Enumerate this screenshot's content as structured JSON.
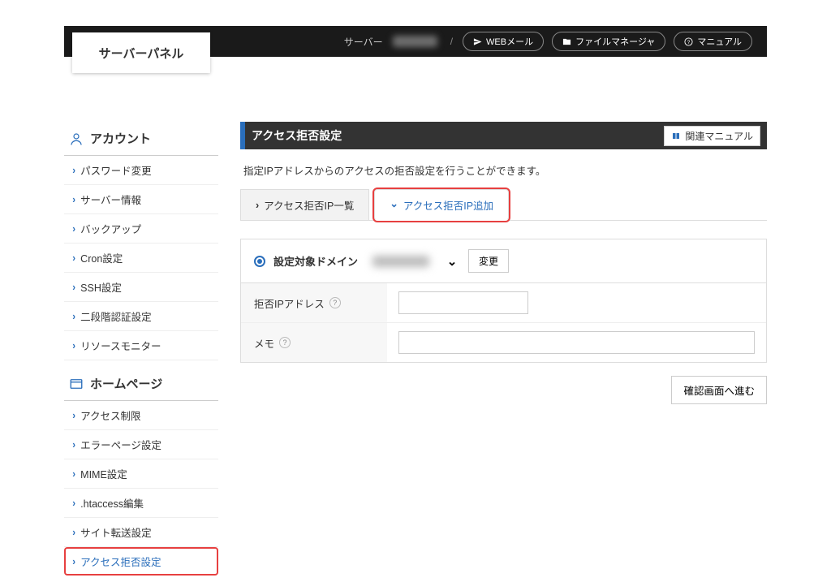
{
  "header": {
    "logo": "サーバーパネル",
    "server_label": "サーバー",
    "webmail": "WEBメール",
    "filemanager": "ファイルマネージャ",
    "manual": "マニュアル"
  },
  "sidebar": {
    "account": {
      "title": "アカウント",
      "items": [
        {
          "label": "パスワード変更"
        },
        {
          "label": "サーバー情報"
        },
        {
          "label": "バックアップ"
        },
        {
          "label": "Cron設定"
        },
        {
          "label": "SSH設定"
        },
        {
          "label": "二段階認証設定"
        },
        {
          "label": "リソースモニター"
        }
      ]
    },
    "homepage": {
      "title": "ホームページ",
      "items": [
        {
          "label": "アクセス制限"
        },
        {
          "label": "エラーページ設定"
        },
        {
          "label": "MIME設定"
        },
        {
          "label": ".htaccess編集"
        },
        {
          "label": "サイト転送設定"
        },
        {
          "label": "アクセス拒否設定"
        }
      ]
    }
  },
  "main": {
    "title": "アクセス拒否設定",
    "manual_btn": "関連マニュアル",
    "description": "指定IPアドレスからのアクセスの拒否設定を行うことができます。",
    "tabs": {
      "list": "アクセス拒否IP一覧",
      "add": "アクセス拒否IP追加"
    },
    "domain_row": {
      "label": "設定対象ドメイン",
      "change_btn": "変更"
    },
    "fields": {
      "ip_label": "拒否IPアドレス",
      "memo_label": "メモ"
    },
    "submit": "確認画面へ進む"
  }
}
